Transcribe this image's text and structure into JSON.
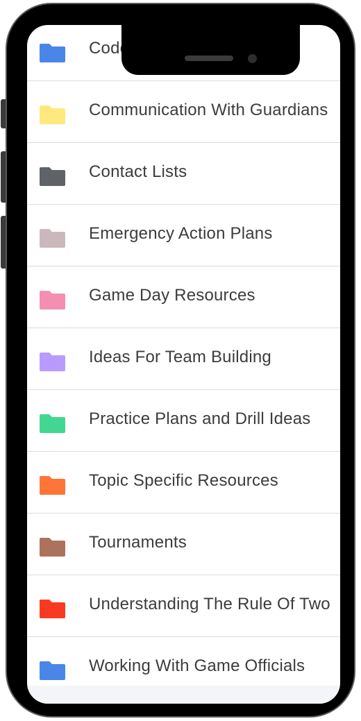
{
  "folders": [
    {
      "label": "Codes of Conduct",
      "color": "#4a86e8"
    },
    {
      "label": "Communication With Guardians",
      "color": "#fde97d"
    },
    {
      "label": "Contact Lists",
      "color": "#5f6368"
    },
    {
      "label": "Emergency Action Plans",
      "color": "#cbb8bd"
    },
    {
      "label": "Game Day Resources",
      "color": "#f38fb1"
    },
    {
      "label": "Ideas For Team Building",
      "color": "#b99aff"
    },
    {
      "label": "Practice Plans and Drill Ideas",
      "color": "#43d692"
    },
    {
      "label": "Topic Specific Resources",
      "color": "#ff7537"
    },
    {
      "label": "Tournaments",
      "color": "#ac725e"
    },
    {
      "label": "Understanding The Rule Of Two",
      "color": "#f83a22"
    },
    {
      "label": "Working With Game Officials",
      "color": "#4a86e8"
    }
  ]
}
